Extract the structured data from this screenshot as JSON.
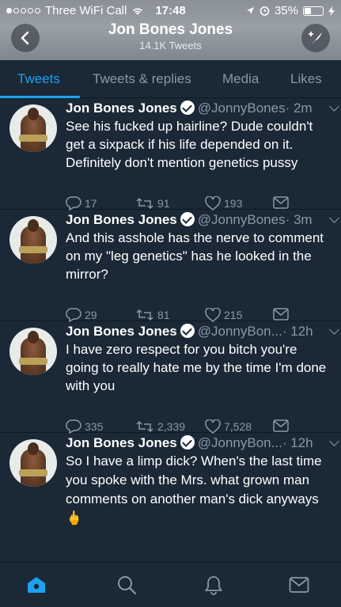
{
  "status_bar": {
    "carrier": "Three WiFi Call",
    "time": "17:48",
    "battery": "35%",
    "battery_level": 0.35,
    "icons": [
      "signal-dots-icon",
      "wifi-icon",
      "location-icon",
      "alarm-icon",
      "charging-icon"
    ]
  },
  "nav": {
    "title": "Jon Bones Jones",
    "subtitle": "14.1K Tweets",
    "icons": [
      "back-chevron-icon",
      "compose-tweet-icon"
    ]
  },
  "tabs": [
    {
      "label": "Tweets",
      "active": true
    },
    {
      "label": "Tweets & replies",
      "active": false
    },
    {
      "label": "Media",
      "active": false
    },
    {
      "label": "Likes",
      "active": false
    }
  ],
  "tweets": [
    {
      "name": "Jon Bones Jones",
      "handle": "@JonnyBones",
      "time": "· 2m",
      "text": "See his fucked up hairline? Dude couldn't get a sixpack if his life depended on it. Definitely don't mention genetics pussy",
      "replies": "17",
      "retweets": "91",
      "likes": "193"
    },
    {
      "name": "Jon Bones Jones",
      "handle": "@JonnyBones",
      "time": "· 3m",
      "text": "And this asshole has the nerve to comment on my \"leg genetics\" has he looked in the mirror?",
      "replies": "29",
      "retweets": "81",
      "likes": "215"
    },
    {
      "name": "Jon Bones Jones",
      "handle": "@JonnyBon...",
      "time": "· 12h",
      "text": "I have zero respect for you bitch you're going to really hate me by the time I'm done with you",
      "replies": "335",
      "retweets": "2,339",
      "likes": "7,528"
    },
    {
      "name": "Jon Bones Jones",
      "handle": "@JonnyBon...",
      "time": "· 12h",
      "text": "So I have a limp dick? When's the last time you spoke with the Mrs. what grown man comments on another man's dick anyways 🖕",
      "replies": "",
      "retweets": "",
      "likes": ""
    }
  ],
  "tabbar": {
    "icons": [
      "home-icon",
      "search-icon",
      "notifications-bell-icon",
      "messages-envelope-icon"
    ],
    "active_color": "#1da1f2",
    "inactive_color": "#8899a6"
  },
  "colors": {
    "background": "#1b2836",
    "accent": "#1da1f2",
    "secondary_text": "#8899a6"
  }
}
